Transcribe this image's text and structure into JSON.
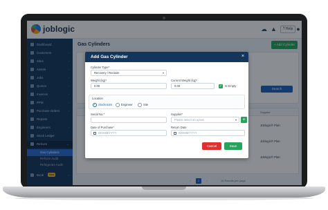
{
  "app": {
    "logo_text": "joblogic",
    "page_title": "Gas Cylinders",
    "add_button": "+ Add Cylinder",
    "help_label": "? Help"
  },
  "icons": {
    "logo": "joblogic-logo-icon",
    "cloud": "cloud-icon",
    "bell": "bell-icon",
    "avatar": "user-icon",
    "close": "close-icon"
  },
  "sidebar": {
    "items": [
      {
        "label": "Dashboard",
        "chevron": ""
      },
      {
        "label": "Customers",
        "chevron": "›"
      },
      {
        "label": "Sites",
        "chevron": "›"
      },
      {
        "label": "Assets",
        "chevron": "›"
      },
      {
        "label": "Jobs",
        "chevron": "›"
      },
      {
        "label": "Quotes",
        "chevron": "›"
      },
      {
        "label": "Invoices",
        "chevron": "›"
      },
      {
        "label": "PPM",
        "chevron": "›"
      },
      {
        "label": "Purchase Orders",
        "chevron": "›"
      },
      {
        "label": "Reports",
        "chevron": ""
      },
      {
        "label": "Engineers",
        "chevron": "›"
      },
      {
        "label": "Stock Ledger",
        "chevron": ""
      },
      {
        "label": "Refcom",
        "chevron": "⌄"
      }
    ],
    "sub_items": [
      {
        "label": "Gas Cylinders"
      },
      {
        "label": "Refcom Audit"
      },
      {
        "label": "Refrigerant Audit"
      }
    ],
    "bottom_item": {
      "label": "Book",
      "badge": "New"
    }
  },
  "table": {
    "headers": [
      "Engineer",
      "Supplier"
    ],
    "rows": [
      {
        "supplier": "Joblogic® Plan"
      },
      {
        "supplier": "Joblogic® Plan"
      },
      {
        "supplier": "Joblogic® Plan"
      }
    ],
    "search_label": "Search",
    "per_page_label": "10 Results per page",
    "current_page": "1"
  },
  "modal": {
    "title": "Add Gas Cylinder",
    "close": "×",
    "cylinder_type_label": "Cylinder Type*",
    "cylinder_type_value": "Recovery / Reclaim",
    "weight_label": "Weight (kg)*",
    "weight_value": "0.00",
    "current_weight_label": "Current Weight (kg)*",
    "current_weight_value": "0.00",
    "is_empty_label": "Is Empty",
    "location_label": "Location",
    "location_options": [
      "Stockroom",
      "Engineer",
      "Site"
    ],
    "location_selected": "Stockroom",
    "serial_label": "Serial No.*",
    "serial_value": "",
    "supplier_label": "Supplier*",
    "supplier_placeholder": "Please select an option",
    "purchase_date_label": "Date of Purchase*",
    "purchase_date_placeholder": "DD/MM/YYYY",
    "return_date_label": "Return Date",
    "return_date_placeholder": "DD/MM/YYYY",
    "cancel_label": "Cancel",
    "save_label": "Save"
  },
  "colors": {
    "navy": "#15365c",
    "sidebar": "#14345a",
    "green": "#25a45a",
    "red": "#e0312f",
    "blue": "#1d5fb8"
  }
}
